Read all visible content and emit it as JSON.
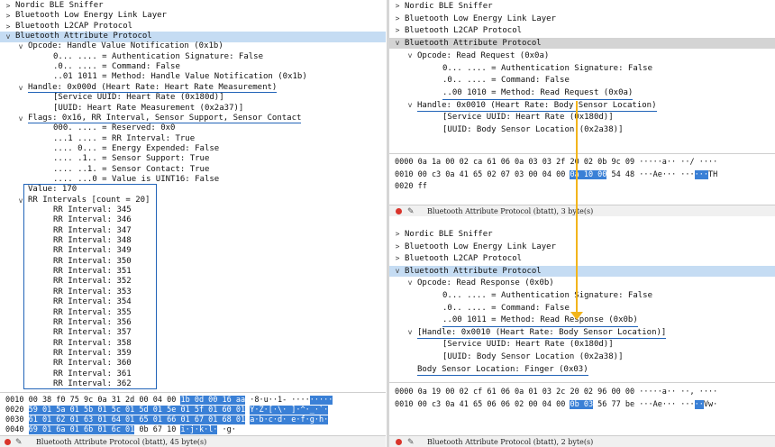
{
  "left": {
    "tree": [
      {
        "t": ">",
        "l": "Nordic BLE Sniffer",
        "i": 0
      },
      {
        "t": ">",
        "l": "Bluetooth Low Energy Link Layer",
        "i": 0
      },
      {
        "t": ">",
        "l": "Bluetooth L2CAP Protocol",
        "i": 0
      },
      {
        "t": "v",
        "l": "Bluetooth Attribute Protocol",
        "i": 0,
        "sel": true
      },
      {
        "t": "v",
        "l": "Opcode: Handle Value Notification (0x1b)",
        "i": 1
      },
      {
        "t": "",
        "l": "0... .... = Authentication Signature: False",
        "i": 3
      },
      {
        "t": "",
        "l": ".0.. .... = Command: False",
        "i": 3
      },
      {
        "t": "",
        "l": "..01 1011 = Method: Handle Value Notification (0x1b)",
        "i": 3
      },
      {
        "t": "v",
        "l": "Handle: 0x000d (Heart Rate: Heart Rate Measurement)",
        "i": 1,
        "ul": true
      },
      {
        "t": "",
        "l": "[Service UUID: Heart Rate (0x180d)]",
        "i": 3
      },
      {
        "t": "",
        "l": "[UUID: Heart Rate Measurement (0x2a37)]",
        "i": 3
      },
      {
        "t": "v",
        "l": "Flags: 0x16, RR Interval, Sensor Support, Sensor Contact",
        "i": 1,
        "ul": true
      },
      {
        "t": "",
        "l": "000. .... = Reserved: 0x0",
        "i": 3
      },
      {
        "t": "",
        "l": "...1 .... = RR Interval: True",
        "i": 3
      },
      {
        "t": "",
        "l": ".... 0... = Energy Expended: False",
        "i": 3
      },
      {
        "t": "",
        "l": ".... .1.. = Sensor Support: True",
        "i": 3
      },
      {
        "t": "",
        "l": ".... ..1. = Sensor Contact: True",
        "i": 3
      },
      {
        "t": "",
        "l": ".... ...0 = Value is UINT16: False",
        "i": 3
      },
      {
        "t": "",
        "l": "Value: 170",
        "i": 1
      },
      {
        "t": "v",
        "l": "RR Intervals [count = 20]",
        "i": 1
      },
      {
        "t": "",
        "l": "RR Interval: 345",
        "i": 3
      },
      {
        "t": "",
        "l": "RR Interval: 346",
        "i": 3
      },
      {
        "t": "",
        "l": "RR Interval: 347",
        "i": 3
      },
      {
        "t": "",
        "l": "RR Interval: 348",
        "i": 3
      },
      {
        "t": "",
        "l": "RR Interval: 349",
        "i": 3
      },
      {
        "t": "",
        "l": "RR Interval: 350",
        "i": 3
      },
      {
        "t": "",
        "l": "RR Interval: 351",
        "i": 3
      },
      {
        "t": "",
        "l": "RR Interval: 352",
        "i": 3
      },
      {
        "t": "",
        "l": "RR Interval: 353",
        "i": 3
      },
      {
        "t": "",
        "l": "RR Interval: 354",
        "i": 3
      },
      {
        "t": "",
        "l": "RR Interval: 355",
        "i": 3
      },
      {
        "t": "",
        "l": "RR Interval: 356",
        "i": 3
      },
      {
        "t": "",
        "l": "RR Interval: 357",
        "i": 3
      },
      {
        "t": "",
        "l": "RR Interval: 358",
        "i": 3
      },
      {
        "t": "",
        "l": "RR Interval: 359",
        "i": 3
      },
      {
        "t": "",
        "l": "RR Interval: 360",
        "i": 3
      },
      {
        "t": "",
        "l": "RR Interval: 361",
        "i": 3
      },
      {
        "t": "",
        "l": "RR Interval: 362",
        "i": 3
      }
    ],
    "hex": [
      [
        {
          "s": "0010  00 38 f0 75 9c 0a 31 2d  00 04 00 "
        },
        {
          "s": "1b 0d 00 16 aa",
          "h": true
        },
        {
          "s": "  ·8·u··1-  ····"
        },
        {
          "s": "·····",
          "h": true
        }
      ],
      [
        {
          "s": "0020  "
        },
        {
          "s": "59 01 5a 01 5b 01 5c 01  5d 01 5e 01 5f 01 60 01",
          "h": true
        },
        {
          "s": "  "
        },
        {
          "s": "Y·Z·[·\\· ]·^·_·`·",
          "h": true
        }
      ],
      [
        {
          "s": "0030  "
        },
        {
          "s": "61 01 62 01 63 01 64 01  65 01 66 01 67 01 68 01",
          "h": true
        },
        {
          "s": "  "
        },
        {
          "s": "a·b·c·d· e·f·g·h·",
          "h": true
        }
      ],
      [
        {
          "s": "0040  "
        },
        {
          "s": "69 01 6a 01 6b 01 6c 01",
          "h": true
        },
        {
          "s": "  0b 67 10           "
        },
        {
          "s": "i·j·k·l·",
          "h": true
        },
        {
          "s": " ·g·"
        }
      ]
    ],
    "status": "Bluetooth Attribute Protocol (btatt), 45 byte(s)"
  },
  "right_top": {
    "tree": [
      {
        "t": ">",
        "l": "Nordic BLE Sniffer",
        "i": 0
      },
      {
        "t": ">",
        "l": "Bluetooth Low Energy Link Layer",
        "i": 0
      },
      {
        "t": ">",
        "l": "Bluetooth L2CAP Protocol",
        "i": 0
      },
      {
        "t": "v",
        "l": "Bluetooth Attribute Protocol",
        "i": 0,
        "gray": true
      },
      {
        "t": "v",
        "l": "Opcode: Read Request (0x0a)",
        "i": 1
      },
      {
        "t": "",
        "l": "0... .... = Authentication Signature: False",
        "i": 3
      },
      {
        "t": "",
        "l": ".0.. .... = Command: False",
        "i": 3
      },
      {
        "t": "",
        "l": "..00 1010 = Method: Read Request (0x0a)",
        "i": 3,
        "ul": true
      },
      {
        "t": "v",
        "l": "Handle: 0x0010 (Heart Rate: Body Sensor Location)",
        "i": 1,
        "ul": true
      },
      {
        "t": "",
        "l": "[Service UUID: Heart Rate (0x180d)]",
        "i": 3
      },
      {
        "t": "",
        "l": "[UUID: Body Sensor Location (0x2a38)]",
        "i": 3
      }
    ],
    "hex": [
      [
        {
          "s": "0000  0a 1a 00 02 ca 61 06 0a  03 03 2f 20 02 0b 9c 09   ·····a·· ··/ ····"
        }
      ],
      [
        {
          "s": "0010  00 c3 0a 41 65 02 07 03  00 04 00 "
        },
        {
          "s": "0a 10 00",
          "h": true
        },
        {
          "s": " 54 48   ···Ae··· ···"
        },
        {
          "s": "···",
          "h": true
        },
        {
          "s": "TH"
        }
      ],
      [
        {
          "s": "0020  ff"
        }
      ]
    ],
    "status": "Bluetooth Attribute Protocol (btatt), 3 byte(s)"
  },
  "right_bottom": {
    "tree": [
      {
        "t": ">",
        "l": "Nordic BLE Sniffer",
        "i": 0
      },
      {
        "t": ">",
        "l": "Bluetooth Low Energy Link Layer",
        "i": 0
      },
      {
        "t": ">",
        "l": "Bluetooth L2CAP Protocol",
        "i": 0
      },
      {
        "t": "v",
        "l": "Bluetooth Attribute Protocol",
        "i": 0,
        "sel": true
      },
      {
        "t": "v",
        "l": "Opcode: Read Response (0x0b)",
        "i": 1
      },
      {
        "t": "",
        "l": "0... .... = Authentication Signature: False",
        "i": 3
      },
      {
        "t": "",
        "l": ".0.. .... = Command: False",
        "i": 3
      },
      {
        "t": "",
        "l": "..00 1011 = Method: Read Response (0x0b)",
        "i": 3,
        "ul": true
      },
      {
        "t": "v",
        "l": "[Handle: 0x0010 (Heart Rate: Body Sensor Location)]",
        "i": 1,
        "ul": true
      },
      {
        "t": "",
        "l": "[Service UUID: Heart Rate (0x180d)]",
        "i": 3
      },
      {
        "t": "",
        "l": "[UUID: Body Sensor Location (0x2a38)]",
        "i": 3
      },
      {
        "t": "",
        "l": "Body Sensor Location: Finger (0x03)",
        "i": 1,
        "ul": true
      }
    ],
    "hex": [
      [
        {
          "s": "0000  0a 19 00 02 cf 61 06 0a  01 03 2c 20 02 96 00 00   ·····a·· ··, ····"
        }
      ],
      [
        {
          "s": "0010  00 c3 0a 41 65 06 06 02  00 04 00 "
        },
        {
          "s": "0b 03",
          "h": true
        },
        {
          "s": " 56 77 be   ···Ae··· ···"
        },
        {
          "s": "··",
          "h": true
        },
        {
          "s": "Vw·"
        }
      ]
    ],
    "status": "Bluetooth Attribute Protocol (btatt), 2 byte(s)"
  },
  "colors": {
    "selection": "#c5dcf3",
    "underline": "#2264b8",
    "hex_highlight": "#3a80d6",
    "arrow": "#f2b51c",
    "status_dot": "#d9342b"
  },
  "icons": {
    "expanded": "v",
    "collapsed": ">",
    "status_indicator": "status-dot-icon",
    "edit": "pencil-icon"
  }
}
